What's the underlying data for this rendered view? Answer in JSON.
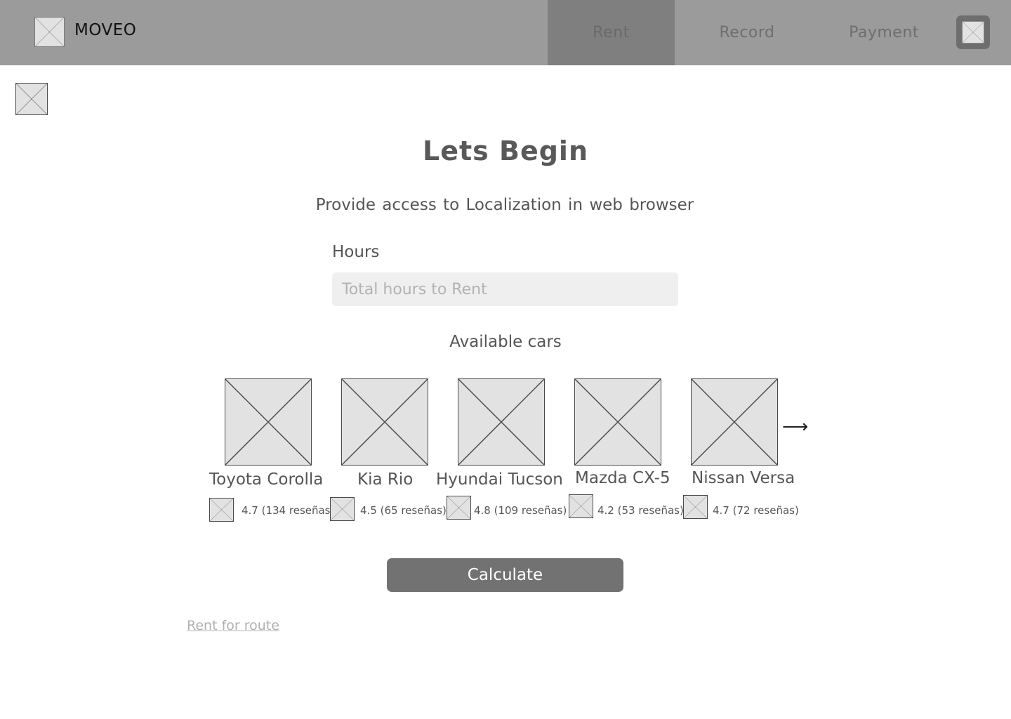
{
  "header": {
    "brand": "MOVEO",
    "nav": [
      {
        "label": "Rent",
        "active": true
      },
      {
        "label": "Record",
        "active": false
      },
      {
        "label": "Payment",
        "active": false
      }
    ]
  },
  "main": {
    "title": "Lets Begin",
    "subtitle": "Provide access to  Localization in  web browser",
    "hours_label": "Hours",
    "hours_placeholder": "Total hours to Rent",
    "cars_label": "Available cars",
    "cars": [
      {
        "name": "Toyota Corolla",
        "rating": "4.7 (134 reseñas)"
      },
      {
        "name": "Kia Rio",
        "rating": "4.5 (65 reseñas)"
      },
      {
        "name": "Hyundai Tucson",
        "rating": "4.8 (109 reseñas)"
      },
      {
        "name": "Mazda CX-5",
        "rating": "4.2 (53 reseñas)"
      },
      {
        "name": "Nissan Versa",
        "rating": "4.7 (72 reseñas)"
      }
    ],
    "next_arrow": "⟶",
    "calculate_label": "Calculate",
    "route_link": "Rent for route"
  },
  "colors": {
    "header_bg": "#9b9b9b",
    "nav_active_bg": "#7f7f7f",
    "button_bg": "#727272",
    "input_bg": "#efefef"
  }
}
